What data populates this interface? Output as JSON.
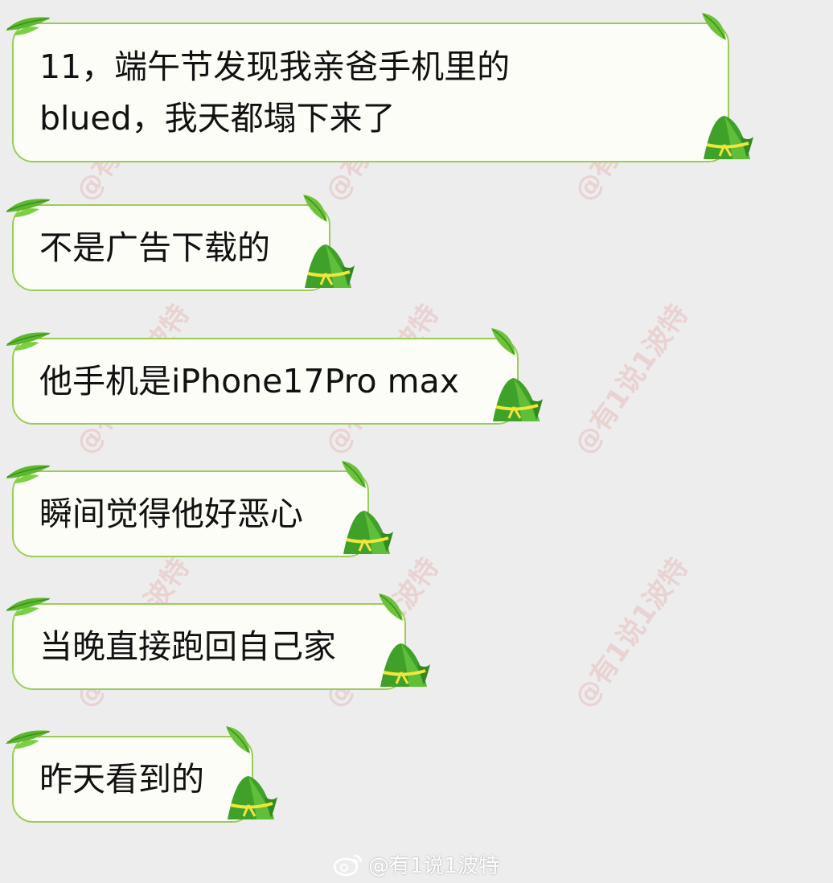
{
  "messages": [
    {
      "text": "11，端午节发现我亲爸手机里的blued，我天都塌下来了"
    },
    {
      "text": "不是广告下载的"
    },
    {
      "text": "他手机是iPhone17Pro max"
    },
    {
      "text": "瞬间觉得他好恶心"
    },
    {
      "text": "当晚直接跑回自己家"
    },
    {
      "text": "昨天看到的"
    }
  ],
  "watermark": {
    "text": "@有1说1波特"
  },
  "footer": {
    "handle": "@有1说1波特",
    "icon": "weibo-icon"
  },
  "colors": {
    "background": "#ededed",
    "bubble_fill": "#fcfdf7",
    "bubble_border": "#9ccb5b",
    "leaf_green": "#5cb82e",
    "zongzi_green": "#3fa12a",
    "ribbon_yellow": "#f2e53c"
  }
}
